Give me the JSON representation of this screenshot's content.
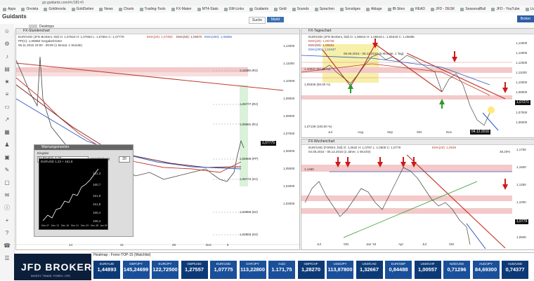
{
  "browser": {
    "url": "go.guidants.com/#c/181=0",
    "bookmarks": [
      "Apps",
      "Onvista",
      "Goldmoola",
      "GoldSeiten",
      "News",
      "Charts",
      "Trading-Tools",
      "FX-Maker",
      "MT4-Stats",
      "GM-Links",
      "Guidants",
      "Geld",
      "Sounds",
      "Sprachen",
      "Sonstiges",
      "Ablage",
      "IB-Sites",
      "READ",
      "JFD - DESK",
      "SeasonalBull",
      "JFD - YouTube",
      "Live - YouTube",
      "Weitere Lesezeichen"
    ]
  },
  "header": {
    "logo": "Guidants",
    "search_label": "Suche",
    "market_label": "Markt",
    "right_button": "Broker Login",
    "desktop_label": "Desktops"
  },
  "panel_left": {
    "title": "FX-Stundenchart",
    "info1": "EUR/USD (JFD Brokers, bid)  O: 1,07623  H: 1,07653  L: 1,07561  C: 1,07775",
    "ema20": "EMA(20): 1,07393",
    "ema50": "EMA(50): 1,06970",
    "ema200": "EMA(200): 1,06866",
    "info2": "PP(C): 1,06968  Vorgabe/Hinter",
    "info3": "06.11.2016 23:00 - 09:00 (1 Monat, 1 Stunde)",
    "levels": [
      "1,11590 (R3)",
      "1,09777 (R2)",
      "1,08681 (R1)",
      "1,07775",
      "1,06969 (PP)",
      "1,05772 (S1)",
      "1,03959 (S2)",
      "1,02863 (S3)"
    ],
    "y_ticks": [
      "1,12000",
      "1,11500",
      "1,11000",
      "1,10500",
      "1,10000",
      "1,09500",
      "1,09000",
      "1,08500",
      "1,08000",
      "1,07500",
      "1,07000",
      "1,06500",
      "1,06000",
      "1,05500",
      "1,05000",
      "1,04500",
      "1,04000",
      "1,03500",
      "1,03000"
    ],
    "x_ticks": [
      "14",
      "21",
      "28",
      "Dez",
      "5"
    ]
  },
  "popup": {
    "title": "Warnungsmonitor",
    "instrument": "EURUSD-7.22",
    "label": "Verschiebung",
    "value": "20",
    "status": "EURUSD 1,22 + 161,8",
    "y_ticks": [
      "161,3",
      "160,7",
      "161,9",
      "161,8",
      "160,4",
      "159,4"
    ],
    "x_ticks": [
      "Dec 07",
      "Dec 12",
      "Dec 16",
      "Dec 21",
      "Dec 23",
      "Dec 28",
      "Jan 02"
    ]
  },
  "panel_top_right": {
    "title": "FX-Tageschart",
    "info1": "EUR/USD (JFD Brokers, bid)  O: 1,06616  H: 1,06616  L: 1,05318  C: 1,05386",
    "ema20": "EMA(20): 1,06736",
    "ema50": "EMA(50): 1,08251",
    "ema200": "EMA(200): 1,10447",
    "info2": "06.06.2016 - 06.12.2016 (6 Monate, 1 Tag)",
    "fib": [
      "1,10047 (61,80 %)",
      "1,09346 (50,00 %)",
      "1,07139 (100,00 %)"
    ],
    "y_ticks": [
      "1,14000",
      "1,13000",
      "1,12000",
      "1,11000",
      "1,10000",
      "1,09000",
      "1,08000",
      "1,07000",
      "1,06000",
      "1,05000"
    ],
    "x_ticks": [
      "Jul",
      "Aug",
      "Sep",
      "Okt",
      "Nov"
    ],
    "date_tag": "04.12.2016",
    "price_tag": "1,07271"
  },
  "panel_bottom_right": {
    "title": "FX-Wochenchart",
    "info1": "EUR/USD (FOREX, bid)  O: 1,0532  H: 1,0797  L: 1,0505  C: 1,0779",
    "ema20": "EMA(20): 1,0939",
    "info2": "04.05.2015 - 05.12.2016 (2 Jahre, 1 Woche)",
    "level_label": "1,1450",
    "pct": "38,20%",
    "y_ticks": [
      "1,1750",
      "1,1500",
      "1,1250",
      "1,1000",
      "1,0750",
      "1,0500"
    ],
    "x_ticks": [
      "Jul",
      "Okt",
      "Jan '16",
      "Apr",
      "Jul",
      "Okt"
    ],
    "price_tag": "1,0779"
  },
  "heatmap": {
    "title": "Heatmap - Forex-TOP-15 (Watchlist)",
    "items": [
      {
        "symbol": "EUR/AUD",
        "value": "1,44893",
        "color": "#0d3a77"
      },
      {
        "symbol": "GBP/JPY",
        "value": "145,24699",
        "color": "#1a4f9a"
      },
      {
        "symbol": "EUR/JPY",
        "value": "122,72500",
        "color": "#1a4f9a"
      },
      {
        "symbol": "GBP/USD",
        "value": "1,27557",
        "color": "#0d3a77"
      },
      {
        "symbol": "EUR/USD",
        "value": "1,07775",
        "color": "#1a4f9a"
      },
      {
        "symbol": "CHF/JPY",
        "value": "113,22800",
        "color": "#1a4f9a"
      },
      {
        "symbol": "Gold",
        "value": "1.171,75",
        "color": "#1a4f9a"
      },
      {
        "symbol": "GBP/CHF",
        "value": "1,28270",
        "color": "#0d3a77"
      },
      {
        "symbol": "USD/JPY",
        "value": "113,87800",
        "color": "#1a4f9a"
      },
      {
        "symbol": "USD/CAD",
        "value": "1,32667",
        "color": "#0d3a77"
      },
      {
        "symbol": "EUR/GBP",
        "value": "0,84488",
        "color": "#1a4f9a"
      },
      {
        "symbol": "USD/CHF",
        "value": "1,00557",
        "color": "#0d3a77"
      },
      {
        "symbol": "NZD/USD",
        "value": "0,71296",
        "color": "#1a4f9a"
      },
      {
        "symbol": "AUD/JPY",
        "value": "84,69300",
        "color": "#1a4f9a"
      },
      {
        "symbol": "AUD/USD",
        "value": "0,74377",
        "color": "#0d3a77"
      }
    ]
  },
  "brand": {
    "jfd": "JFD BROKERS",
    "jfd_sub": "INVEST. TRADE. FOREX. CFD"
  },
  "colors": {
    "red_line": "#c0392b",
    "blue_line": "#2b58c0",
    "pink_zone": "#f3c9c9",
    "yellow_zone": "#f7f0a8",
    "green_arrow": "#2a9a2a",
    "red_arrow": "#d01818"
  }
}
